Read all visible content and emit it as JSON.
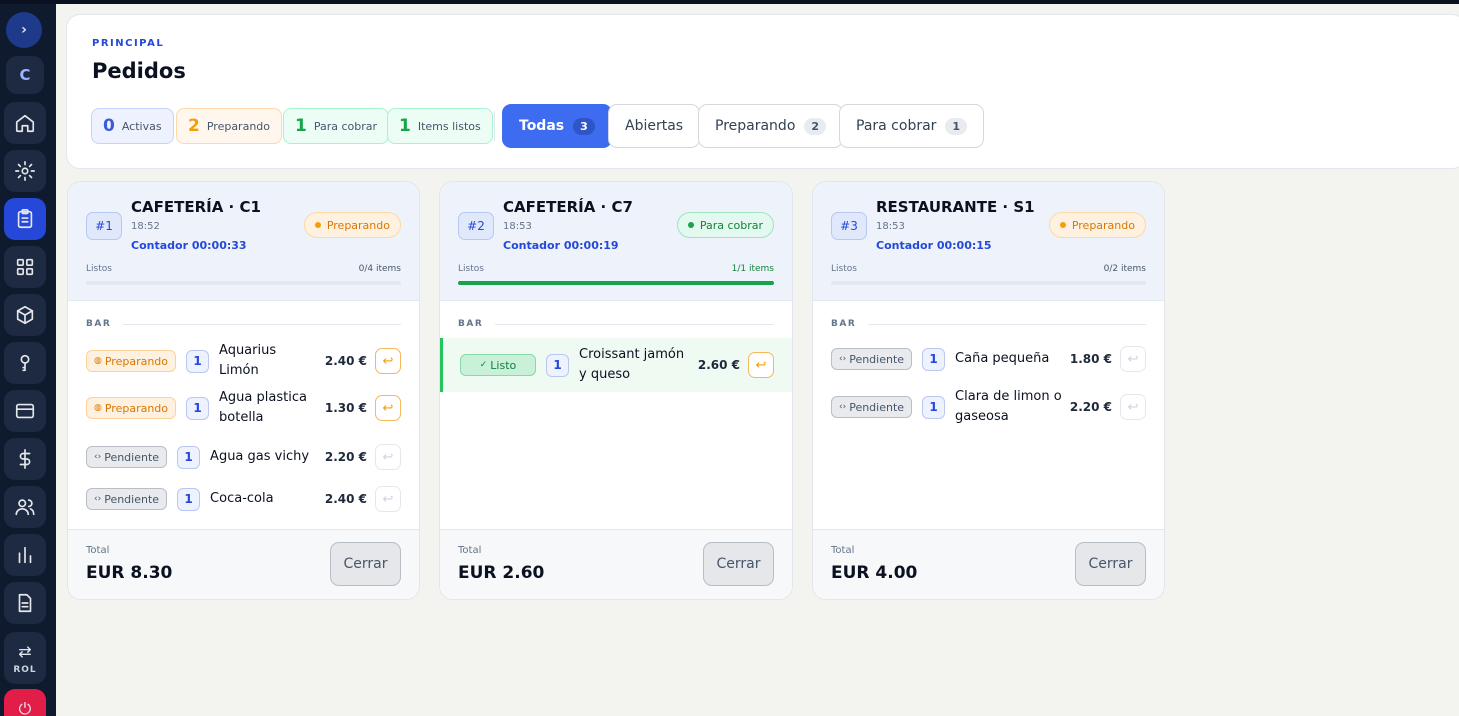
{
  "sidebar": {
    "toggle": "›",
    "brand": "C",
    "icons": [
      "home-icon",
      "settings-icon",
      "orders-icon",
      "grid-icon",
      "box-icon",
      "key-icon",
      "card-icon",
      "dollar-icon",
      "users-icon",
      "chart-icon",
      "document-icon"
    ],
    "active": "orders-icon",
    "rol_label": "ROL",
    "rol_icon": "⇄",
    "power_icon": "⏻"
  },
  "header": {
    "eyebrow": "PRINCIPAL",
    "title": "Pedidos",
    "stats": [
      {
        "value": "0",
        "label": "Activas"
      },
      {
        "value": "2",
        "label": "Preparando"
      },
      {
        "value": "1",
        "label": "Para cobrar"
      },
      {
        "value": "1",
        "label": "Items listos"
      }
    ],
    "filters": [
      {
        "label": "Todas",
        "count": "3",
        "active": true
      },
      {
        "label": "Abiertas",
        "count": "",
        "active": false
      },
      {
        "label": "Preparando",
        "count": "2",
        "active": false
      },
      {
        "label": "Para cobrar",
        "count": "1",
        "active": false
      }
    ]
  },
  "orders": [
    {
      "number": "#1",
      "title": "CAFETERÍA · C1",
      "time": "18:52",
      "counter": "Contador 00:00:33",
      "status": "Preparando",
      "status_type": "prep",
      "ready_label": "Listos",
      "ready_count": "0/4 items",
      "ready_fraction": 0,
      "section": "BAR",
      "items": [
        {
          "status": "Preparando",
          "status_icon": "◍",
          "qty": "1",
          "name": "Aquarius Limón",
          "price": "2.40 €",
          "return_icon": "↩"
        },
        {
          "status": "Preparando",
          "status_icon": "◍",
          "qty": "1",
          "name": "Agua plastica botella",
          "price": "1.30 €",
          "return_icon": "↩"
        },
        {
          "status": "Pendiente",
          "status_icon": "‹›",
          "qty": "1",
          "name": "Agua gas vichy",
          "price": "2.20 €",
          "return_icon": "↩"
        },
        {
          "status": "Pendiente",
          "status_icon": "‹›",
          "qty": "1",
          "name": "Coca-cola",
          "price": "2.40 €",
          "return_icon": "↩"
        }
      ],
      "total_label": "Total",
      "total": "EUR 8.30",
      "close_label": "Cerrar"
    },
    {
      "number": "#2",
      "title": "CAFETERÍA · C7",
      "time": "18:53",
      "counter": "Contador 00:00:19",
      "status": "Para cobrar",
      "status_type": "cobrar",
      "ready_label": "Listos",
      "ready_count": "1/1 items",
      "ready_fraction": 1,
      "section": "BAR",
      "items": [
        {
          "status": "Listo",
          "status_icon": "✓",
          "qty": "1",
          "name": "Croissant jamón y queso",
          "price": "2.60 €",
          "return_icon": "↩"
        }
      ],
      "total_label": "Total",
      "total": "EUR 2.60",
      "close_label": "Cerrar"
    },
    {
      "number": "#3",
      "title": "RESTAURANTE · S1",
      "time": "18:53",
      "counter": "Contador 00:00:15",
      "status": "Preparando",
      "status_type": "prep",
      "ready_label": "Listos",
      "ready_count": "0/2 items",
      "ready_fraction": 0,
      "section": "BAR",
      "items": [
        {
          "status": "Pendiente",
          "status_icon": "‹›",
          "qty": "1",
          "name": "Caña pequeña",
          "price": "1.80 €",
          "return_icon": "↩"
        },
        {
          "status": "Pendiente",
          "status_icon": "‹›",
          "qty": "1",
          "name": "Clara de limon o gaseosa",
          "price": "2.20 €",
          "return_icon": "↩"
        }
      ],
      "total_label": "Total",
      "total": "EUR 4.00",
      "close_label": "Cerrar"
    }
  ]
}
